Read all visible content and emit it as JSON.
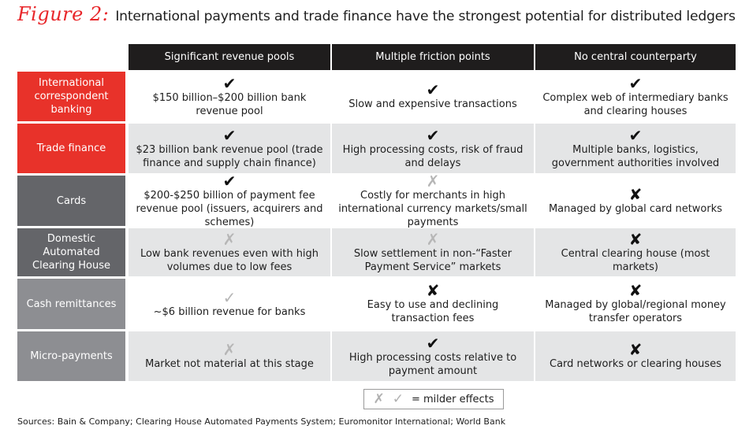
{
  "title": {
    "figure_label": "Figure 2:",
    "text": "International payments and trade finance have the strongest potential for distributed ledgers"
  },
  "columns": [
    "Significant revenue pools",
    "Multiple friction points",
    "No central counterparty"
  ],
  "rows": [
    {
      "label": "International correspondent banking",
      "label_color": "#e8322a",
      "cells": [
        {
          "mark": "✔",
          "mark_type": "check-strong",
          "text": "$150 billion–$200 billion bank revenue pool"
        },
        {
          "mark": "✔",
          "mark_type": "check-strong",
          "text": "Slow and expensive transactions"
        },
        {
          "mark": "✔",
          "mark_type": "check-strong",
          "text": "Complex web of intermediary banks and clearing houses"
        }
      ]
    },
    {
      "label": "Trade finance",
      "label_color": "#e8322a",
      "cells": [
        {
          "mark": "✔",
          "mark_type": "check-strong",
          "text": "$23 billion bank revenue pool (trade finance and supply chain finance)"
        },
        {
          "mark": "✔",
          "mark_type": "check-strong",
          "text": "High processing costs, risk of fraud and delays"
        },
        {
          "mark": "✔",
          "mark_type": "check-strong",
          "text": "Multiple banks, logistics, government authorities involved"
        }
      ]
    },
    {
      "label": "Cards",
      "label_color": "#646569",
      "cells": [
        {
          "mark": "✔",
          "mark_type": "check-strong",
          "text": "$200-$250 billion of payment fee revenue pool (issuers, acquirers and schemes)"
        },
        {
          "mark": "✗",
          "mark_type": "faint",
          "text": "Costly for merchants in high international currency markets/small payments"
        },
        {
          "mark": "✘",
          "mark_type": "x-strong",
          "text": "Managed by global card networks"
        }
      ]
    },
    {
      "label": "Domestic Automated Clearing House",
      "label_color": "#646569",
      "cells": [
        {
          "mark": "✗",
          "mark_type": "faint",
          "text": "Low bank revenues even with high volumes due to low fees"
        },
        {
          "mark": "✗",
          "mark_type": "faint",
          "text": "Slow settlement in non-“Faster Payment Service” markets"
        },
        {
          "mark": "✘",
          "mark_type": "x-strong",
          "text": "Central clearing house (most markets)"
        }
      ]
    },
    {
      "label": "Cash remittances",
      "label_color": "#8d8e92",
      "cells": [
        {
          "mark": "✓",
          "mark_type": "faint",
          "text": "~$6 billion revenue for banks"
        },
        {
          "mark": "✘",
          "mark_type": "x-strong",
          "text": "Easy to use and declining transaction fees"
        },
        {
          "mark": "✘",
          "mark_type": "x-strong",
          "text": "Managed by global/regional money transfer operators"
        }
      ]
    },
    {
      "label": "Micro-payments",
      "label_color": "#8d8e92",
      "cells": [
        {
          "mark": "✗",
          "mark_type": "faint",
          "text": "Market not material at this stage"
        },
        {
          "mark": "✔",
          "mark_type": "check-strong",
          "text": "High processing costs relative to payment amount"
        },
        {
          "mark": "✘",
          "mark_type": "x-strong",
          "text": "Card networks or clearing houses"
        }
      ]
    }
  ],
  "legend": {
    "icons": [
      "✗",
      "✓"
    ],
    "text": "= milder effects"
  },
  "sources": "Sources: Bain & Company; Clearing House Automated Payments System; Euromonitor International; World Bank"
}
